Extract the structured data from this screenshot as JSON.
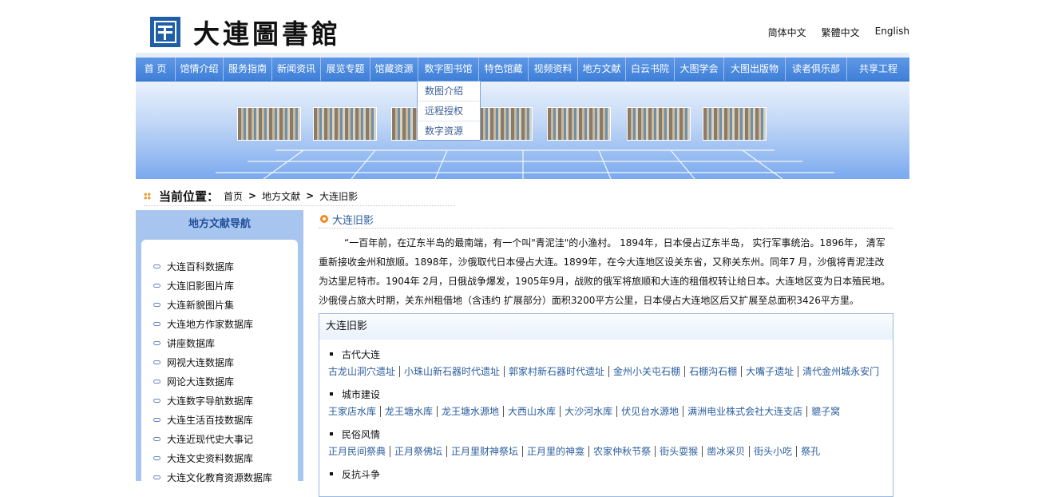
{
  "header": {
    "logo_text": "大連圖書館",
    "languages": [
      "简体中文",
      "繁體中文",
      "English"
    ]
  },
  "nav": {
    "items": [
      "首 页",
      "馆情介绍",
      "服务指南",
      "新闻资讯",
      "展览专题",
      "馆藏资源",
      "数字图书馆",
      "特色馆藏",
      "视频资料",
      "地方文献",
      "白云书院",
      "大图学会",
      "大图出版物",
      "读者俱乐部",
      "共享工程"
    ],
    "dropdown": [
      "数图介绍",
      "远程授权",
      "数字资源"
    ]
  },
  "breadcrumb": {
    "label": "当前位置：",
    "items": [
      "首页",
      "地方文献",
      "大连旧影"
    ],
    "separator": ">"
  },
  "sidebar": {
    "title": "地方文献导航",
    "items": [
      "大连百科数据库",
      "大连旧影图片库",
      "大连新貌图片集",
      "大连地方作家数据库",
      "讲座数据库",
      "网视大连数据库",
      "网论大连数据库",
      "大连数字导航数据库",
      "大连生活百技数据库",
      "大连近现代史大事记",
      "大连文史资料数据库",
      "大连文化教育资源数据库"
    ]
  },
  "main": {
    "section_title": "大连旧影",
    "intro": "“一百年前，在辽东半岛的最南端，有一个叫\"青泥洼\"的小渔村。 1894年，日本侵占辽东半岛， 实行军事统治。1896年， 清军重新接收金州和旅顺。1898年，沙俄取代日本侵占大连。1899年，在今大连地区设关东省，又称关东州。同年7 月，沙俄将青泥洼改为达里尼特市。1904年 2月，日俄战争爆发，1905年9月，战败的俄军将旅顺和大连的租借权转让给日本。大连地区变为日本殖民地。沙俄侵占旅大时期，关东州租借地（含违约 扩展部分）面积3200平方公里，日本侵占大连地区后又扩展至总面积3426平方里。",
    "box_title": "大连旧影",
    "categories": [
      {
        "name": "古代大连",
        "links": [
          "古龙山洞穴遗址",
          "小珠山新石器时代遗址",
          "郭家村新石器时代遗址",
          "金州小关屯石棚",
          "石棚沟石棚",
          "大嘴子遗址",
          "清代金州城永安门"
        ]
      },
      {
        "name": "城市建设",
        "links": [
          "王家店水库",
          "龙王塘水库",
          "龙王塘水源地",
          "大西山水库",
          "大沙河水库",
          "伏见台水源地",
          "满洲电业株式会社大连支店",
          "貔子窝"
        ]
      },
      {
        "name": "民俗风情",
        "links": [
          "正月民间祭典",
          "正月祭佛坛",
          "正月里财神祭坛",
          "正月里的神龛",
          "农家仲秋节祭",
          "街头耍猴",
          "凿冰采贝",
          "街头小吃",
          "祭孔"
        ]
      },
      {
        "name": "反抗斗争",
        "links": []
      }
    ]
  }
}
